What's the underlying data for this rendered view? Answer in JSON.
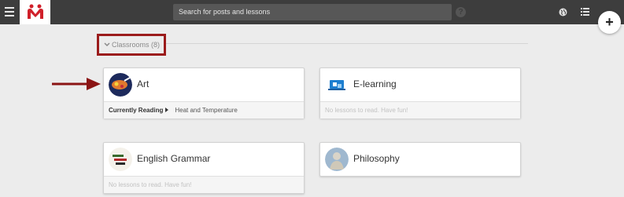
{
  "header": {
    "search_placeholder": "Search for posts and lessons",
    "help_label": "?",
    "add_label": "+"
  },
  "classrooms": {
    "toggle_label": "Classrooms (8)",
    "chevron": "⌄"
  },
  "cards": [
    {
      "title": "Art",
      "footer_label": "Currently Reading",
      "footer_value": "Heat and Temperature",
      "avatar_icon": "art-avatar-icon"
    },
    {
      "title": "E-learning",
      "footer_text": "No lessons to read. Have fun!",
      "avatar_icon": "elearning-avatar-icon"
    },
    {
      "title": "English Grammar",
      "footer_text": "No lessons to read. Have fun!",
      "avatar_icon": "english-grammar-avatar-icon"
    },
    {
      "title": "Philosophy",
      "footer_text": "No lessons to read. Have fun!",
      "avatar_icon": "philosophy-avatar-icon"
    }
  ],
  "colors": {
    "topbar": "#3d3d3d",
    "highlight": "#9b1c1c",
    "logo_red": "#d0202a"
  }
}
